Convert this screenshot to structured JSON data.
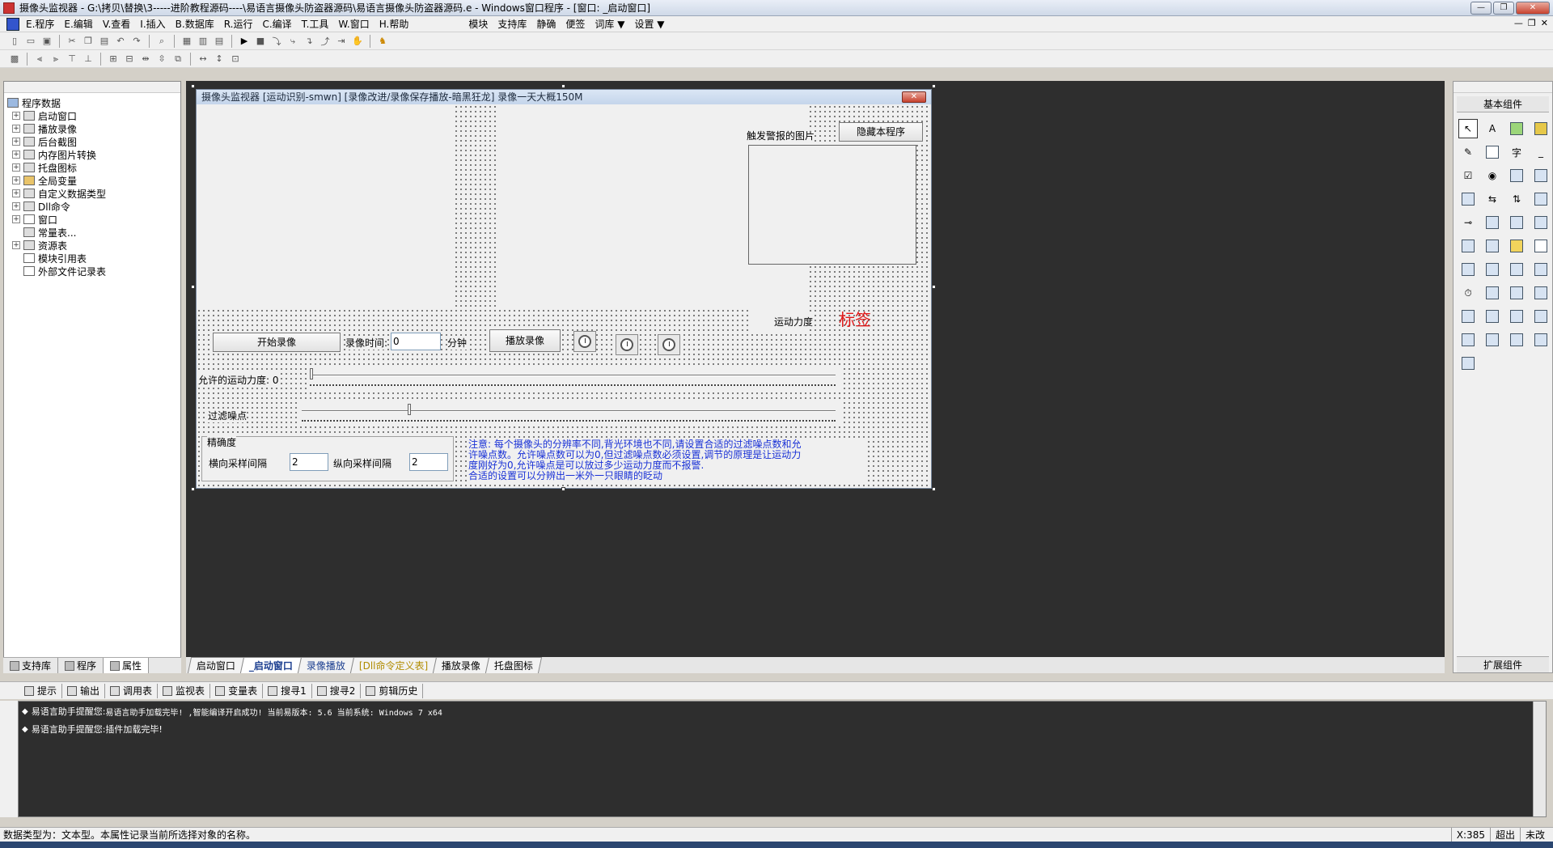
{
  "window": {
    "title": "摄像头监视器 - G:\\拷贝\\替换\\3-----进阶教程源码----\\易语言摄像头防盗器源码\\易语言摄像头防盗器源码.e - Windows窗口程序 - [窗口: _启动窗口]",
    "min": "—",
    "restore": "❐",
    "close": "✕"
  },
  "menu": {
    "items": [
      "E.程序",
      "E.编辑",
      "V.查看",
      "I.插入",
      "B.数据库",
      "R.运行",
      "C.编译",
      "T.工具",
      "W.窗口",
      "H.帮助"
    ],
    "extra": [
      "模块",
      "支持库",
      "静确",
      "便签",
      "词库 ▼",
      "设置 ▼"
    ],
    "right_controls": [
      "—",
      "❐",
      "✕"
    ]
  },
  "left_panel": {
    "tree": [
      {
        "label": "程序数据",
        "level": 0,
        "exp": ""
      },
      {
        "label": "启动窗口",
        "level": 1,
        "exp": "+"
      },
      {
        "label": "播放录像",
        "level": 1,
        "exp": "+"
      },
      {
        "label": "后台截图",
        "level": 1,
        "exp": "+"
      },
      {
        "label": "内存图片转换",
        "level": 1,
        "exp": "+"
      },
      {
        "label": "托盘图标",
        "level": 1,
        "exp": "+"
      },
      {
        "label": "全局变量",
        "level": 1,
        "exp": "+"
      },
      {
        "label": "自定义数据类型",
        "level": 1,
        "exp": "+"
      },
      {
        "label": "Dll命令",
        "level": 1,
        "exp": "+"
      },
      {
        "label": "窗口",
        "level": 1,
        "exp": "+"
      },
      {
        "label": "常量表...",
        "level": 1,
        "exp": ""
      },
      {
        "label": "资源表",
        "level": 1,
        "exp": "+"
      },
      {
        "label": "模块引用表",
        "level": 1,
        "exp": ""
      },
      {
        "label": "外部文件记录表",
        "level": 1,
        "exp": ""
      }
    ],
    "tabs": [
      "支持库",
      "程序",
      "属性"
    ]
  },
  "form": {
    "title": "摄像头监视器 [运动识别-smwn] [录像改进/录像保存播放-暗黑狂龙]  录像一天大概150M",
    "close": "✕",
    "trigger_label": "触发警报的图片",
    "hide_button": "隐藏本程序",
    "motion_label": "运动力度",
    "tag_label": "标签",
    "start_record": "开始录像",
    "record_time_label": "录像时间:",
    "record_time_value": "0",
    "minutes_label": "分钟",
    "play_record": "播放录像",
    "allowed_motion_label": "允许的运动力度: 0",
    "filter_noise_label": "过滤噪点",
    "precision_group": "精确度",
    "h_sample_label": "横向采样间隔",
    "h_sample_value": "2",
    "v_sample_label": "纵向采样间隔",
    "v_sample_value": "2",
    "note_line1": "注意: 每个摄像头的分辨率不同,背光环境也不同,请设置合适的过滤噪点数和允",
    "note_line2": "许噪点数。允许噪点数可以为0,但过滤噪点数必须设置,调节的原理是让运动力",
    "note_line3": "度刚好为0,允许噪点是可以放过多少运动力度而不报警.",
    "note_line4": "合适的设置可以分辨出一米外一只眼睛的眨动",
    "slider_allowed": 0,
    "slider_filter": 0.2
  },
  "design_tabs": [
    "启动窗口",
    "_启动窗口",
    "录像播放",
    "[Dll命令定义表]",
    "播放录像",
    "托盘图标"
  ],
  "right_panel": {
    "title": "基本组件",
    "bottom": "扩展组件"
  },
  "output_tabs": [
    "提示",
    "输出",
    "调用表",
    "监视表",
    "变量表",
    "搜寻1",
    "搜寻2",
    "剪辑历史"
  ],
  "output_lines": [
    {
      "prefix": "易语言助手提醒您:",
      "text": "易语言助手加载完毕!  ,智能编译开启成功!  当前易版本: 5.6  当前系统: Windows 7 x64"
    },
    {
      "prefix": "易语言助手提醒您:",
      "text": "插件加载完毕!"
    }
  ],
  "status": {
    "text": "数据类型为：文本型。本属性记录当前所选择对象的名称。",
    "coords": "X:385",
    "mode": "超出",
    "extra": "未改"
  }
}
